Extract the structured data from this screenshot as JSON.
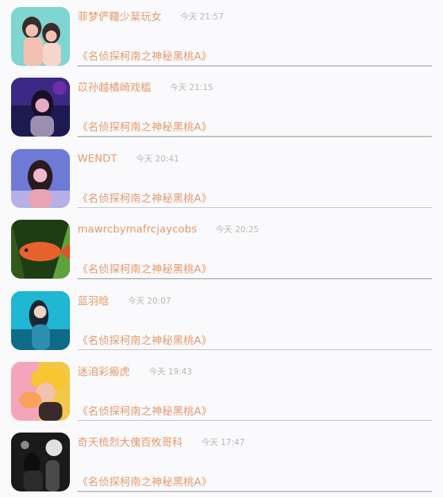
{
  "items": [
    {
      "name": "菲梦俨韁少棻玩女",
      "time": "今天 21:57",
      "subtitle": "《名侦探柯南之神秘黑桃A》",
      "avatar_colors": [
        "#7fd5d0",
        "#f3c1b1",
        "#3a2b2b"
      ]
    },
    {
      "name": "苡孙越橘崎戏槛",
      "time": "今天 21:15",
      "subtitle": "《名侦探柯南之神秘黑桃A》",
      "avatar_colors": [
        "#1d1a52",
        "#6b2ea3",
        "#e6a9c6"
      ]
    },
    {
      "name": "WENDT",
      "time": "今天 20:41",
      "subtitle": "《名侦探柯南之神秘黑桃A》",
      "avatar_colors": [
        "#6d7ad6",
        "#f0b8c8",
        "#2a1b20"
      ]
    },
    {
      "name": "mawrcbymafrcjaycobs",
      "time": "今天 20:25",
      "subtitle": "《名侦探柯南之神秘黑桃A》",
      "avatar_colors": [
        "#1f3d13",
        "#e8622e",
        "#5fa23b"
      ]
    },
    {
      "name": "蓝羽晗",
      "time": "今天 20:07",
      "subtitle": "《名侦探柯南之神秘黑桃A》",
      "avatar_colors": [
        "#1fb7d4",
        "#0f6b86",
        "#1a2633"
      ]
    },
    {
      "name": "迷洎彩瘢虎",
      "time": "今天 19:43",
      "subtitle": "《名侦探柯南之神秘黑桃A》",
      "avatar_colors": [
        "#f2c84b",
        "#f7a15a",
        "#3a2b2b"
      ]
    },
    {
      "name": "奇天梳烈大傀百攸哥科",
      "time": "今天 17:47",
      "subtitle": "《名侦探柯南之神秘黑桃A》",
      "avatar_colors": [
        "#1a1a1a",
        "#8a8a8a",
        "#e0e0e0"
      ]
    }
  ]
}
